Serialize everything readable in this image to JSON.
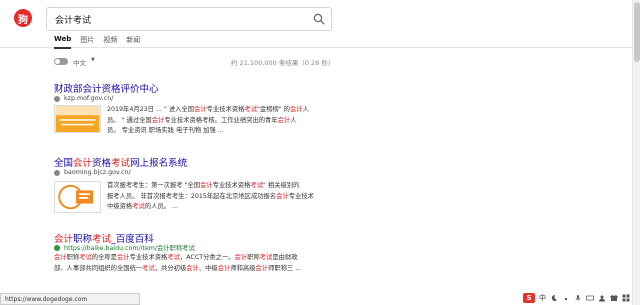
{
  "header": {
    "logo_text": "狗",
    "search": {
      "value": "会计考试"
    },
    "tabs": [
      {
        "label": "Web",
        "active": true
      },
      {
        "label": "图片",
        "active": false
      },
      {
        "label": "视频",
        "active": false
      },
      {
        "label": "新闻",
        "active": false
      }
    ]
  },
  "tools": {
    "language": "中文",
    "language_caret": "▼",
    "result_stats": "约 21,100,000 条结果（0.28 秒）"
  },
  "results": [
    {
      "title": "财政部会计资格评价中心",
      "url": "kzp.mof.gov.cn/",
      "snippet_lines": [
        [
          "2019年4月23日 ... \" 进入全国",
          {
            "hl": "会计"
          },
          "专业技术资格",
          {
            "hl": "考试"
          },
          "\"金榜榜\" 的",
          {
            "hl": "会计"
          },
          "人"
        ],
        [
          "员。 \" 通过全国",
          {
            "hl": "会计"
          },
          "专业技术资格考核。工作业绩突出的青年",
          {
            "hl": "会计"
          },
          "人"
        ],
        [
          "员。 专业资讯 职场实践 电子刊物 加强 ..."
        ]
      ]
    },
    {
      "title_parts": [
        "全国",
        {
          "hl": "会计"
        },
        "资格",
        {
          "hl": "考试"
        },
        "网上报名系统"
      ],
      "url": "baoming.bjcz.gov.cn/",
      "snippet_lines": [
        [
          "首次报考考生：第一次报考 \"全国",
          {
            "hl": "会计"
          },
          "专业技术资格",
          {
            "hl": "考试"
          },
          "\" 相关级别的"
        ],
        [
          "报考人员。 非首次报考考生：2015年起在北京地区成功报名",
          {
            "hl": "会计"
          },
          "专业技术"
        ],
        [
          "中级资格",
          {
            "hl": "考试"
          },
          "的人员。 ..."
        ]
      ]
    },
    {
      "title_parts": [
        {
          "hl": "会计"
        },
        "职称",
        {
          "hl": "考试"
        },
        "_百度百科"
      ],
      "url": "https://baike.baidu.com/item/会计职称考试",
      "snippet_lines": [
        [
          {
            "hl": "会计"
          },
          "职称",
          {
            "hl": "考试"
          },
          "的全称是",
          {
            "hl": "会计"
          },
          "专业技术资格",
          {
            "hl": "考试"
          },
          "，ACCT分类之一。",
          {
            "hl": "会计"
          },
          "职称",
          {
            "hl": "考试"
          },
          "是由财政"
        ],
        [
          "部、人事部共同组织的全国统一",
          {
            "hl": "考试"
          },
          "，共分初级",
          {
            "hl": "会计"
          },
          "、中级",
          {
            "hl": "会计"
          },
          "师和高级",
          {
            "hl": "会计"
          },
          "师职称三 ..."
        ]
      ]
    }
  ],
  "status_bar": {
    "url": "https://www.dogedoge.com"
  },
  "ime": {
    "label": "中"
  }
}
